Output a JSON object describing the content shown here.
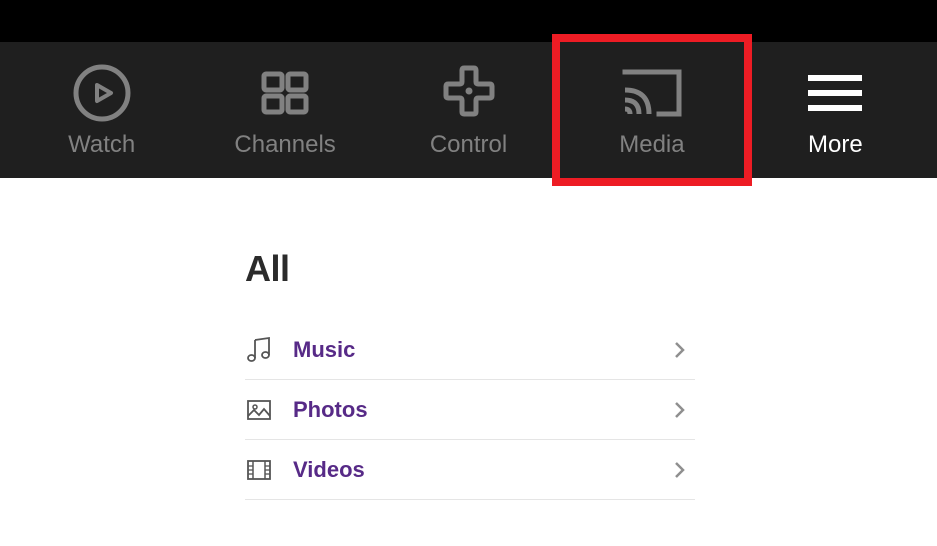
{
  "tabs": {
    "watch": {
      "label": "Watch"
    },
    "channels": {
      "label": "Channels"
    },
    "control": {
      "label": "Control"
    },
    "media": {
      "label": "Media"
    },
    "more": {
      "label": "More"
    }
  },
  "section": {
    "title": "All"
  },
  "list": {
    "items": [
      {
        "label": "Music"
      },
      {
        "label": "Photos"
      },
      {
        "label": "Videos"
      }
    ]
  },
  "colors": {
    "accent": "#572a87",
    "highlight": "#ed1c24"
  }
}
